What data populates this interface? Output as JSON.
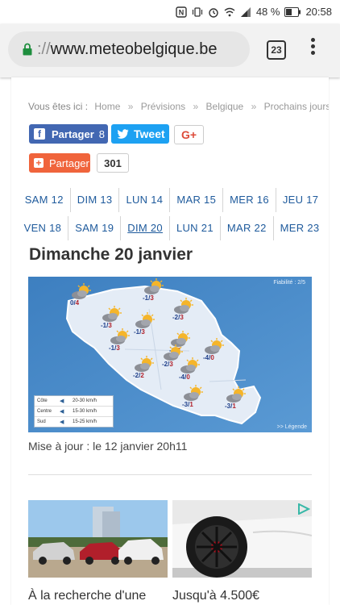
{
  "status_bar": {
    "battery": "48 %",
    "time": "20:58"
  },
  "browser": {
    "url_scheme": "://",
    "url_host": "www.meteobelgique.be",
    "tab_count": "23"
  },
  "breadcrumb": {
    "prefix": "Vous êtes ici :",
    "items": [
      "Home",
      "Prévisions",
      "Belgique",
      "Prochains jours"
    ],
    "separator": "»"
  },
  "social": {
    "facebook_label": "Partager",
    "facebook_count": "8",
    "twitter_label": "Tweet",
    "gplus_label": "G+",
    "share_label": "Partager",
    "share_count": "301"
  },
  "days": {
    "row1": [
      "SAM 12",
      "DIM 13",
      "LUN 14",
      "MAR 15",
      "MER 16",
      "JEU 17"
    ],
    "row2": [
      "VEN 18",
      "SAM 19",
      "DIM 20",
      "LUN 21",
      "MAR 22",
      "MER 23"
    ],
    "active": "DIM 20"
  },
  "forecast": {
    "title": "Dimanche 20 janvier",
    "reliability": "Fiabilité : 2/5",
    "legend_link": ">> Légende",
    "temps": [
      "0/4",
      "-1/3",
      "-1/3",
      "-2/3",
      "-1/3",
      "-1/3",
      "-1/3",
      "-2/3",
      "-4/0",
      "-2/2",
      "-4/0",
      "-3/1",
      "-3/1"
    ],
    "wind": [
      {
        "zone": "Côte",
        "speed": "20-30 km/h"
      },
      {
        "zone": "Centre",
        "speed": "15-30 km/h"
      },
      {
        "zone": "Sud",
        "speed": "15-25 km/h"
      }
    ],
    "update": "Mise à jour : le 12 janvier 20h11"
  },
  "cards": [
    {
      "caption": "À la recherche d'une"
    },
    {
      "caption": "Jusqu'à 4.500€"
    }
  ],
  "colors": {
    "link": "#1e5a9c",
    "facebook": "#4267b2",
    "twitter": "#1da1f2",
    "share": "#f0643c",
    "map_sea": "#4a8cc7"
  }
}
